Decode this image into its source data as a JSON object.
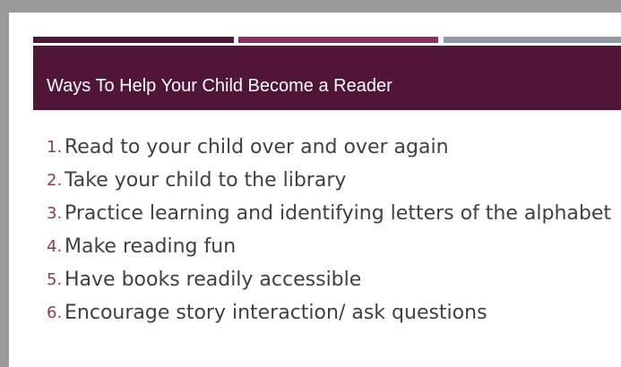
{
  "colors": {
    "outer_background": "#9a9a9a",
    "slide_background": "#ffffff",
    "title_band": "#511537",
    "accent_left": "#511537",
    "accent_middle": "#8f2f62",
    "accent_right": "#8f9aa3",
    "number_color": "#8a3b5d",
    "body_text": "#404040"
  },
  "slide": {
    "title": "Ways To Help Your Child Become a Reader",
    "items": [
      {
        "number": "1.",
        "text": "Read to your child over and over again"
      },
      {
        "number": "2.",
        "text": "Take your child to the library"
      },
      {
        "number": "3.",
        "text": "Practice learning and identifying letters of the alphabet"
      },
      {
        "number": "4.",
        "text": "Make reading fun"
      },
      {
        "number": "5.",
        "text": "Have books readily accessible"
      },
      {
        "number": "6.",
        "text": "Encourage story interaction/ ask questions"
      }
    ]
  }
}
